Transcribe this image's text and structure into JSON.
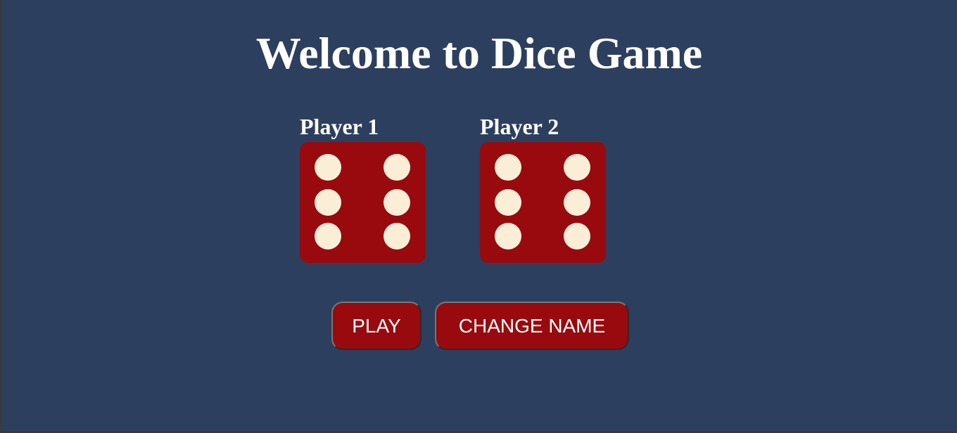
{
  "header": {
    "title": "Welcome to Dice Game"
  },
  "players": [
    {
      "name": "Player 1",
      "die_value": 6
    },
    {
      "name": "Player 2",
      "die_value": 6
    }
  ],
  "controls": {
    "play_label": "PLAY",
    "change_name_label": "CHANGE NAME"
  },
  "colors": {
    "background": "#2d3f5e",
    "die": "#980a0e",
    "pip": "#faefd6",
    "button": "#980a0e",
    "text": "#ffffff"
  }
}
